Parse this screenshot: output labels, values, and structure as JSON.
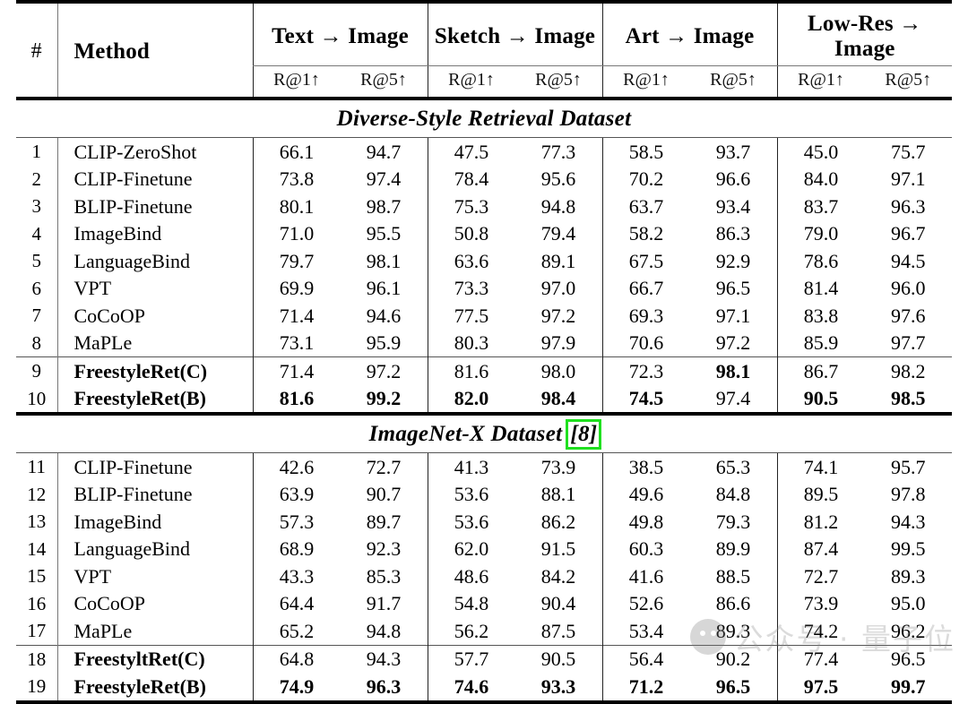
{
  "table": {
    "columns": {
      "num_header": "#",
      "method_header": "Method",
      "groups": [
        {
          "label": "Text → Image",
          "metrics": [
            "R@1↑",
            "R@5↑"
          ]
        },
        {
          "label": "Sketch → Image",
          "metrics": [
            "R@1↑",
            "R@5↑"
          ]
        },
        {
          "label": "Art → Image",
          "metrics": [
            "R@1↑",
            "R@5↑"
          ]
        },
        {
          "label": "Low-Res → Image",
          "metrics": [
            "R@1↑",
            "R@5↑"
          ]
        }
      ]
    },
    "sections": [
      {
        "banner": "Diverse-Style Retrieval Dataset",
        "banner_citation": "",
        "rows": [
          {
            "num": "1",
            "method": "CLIP-ZeroShot",
            "bold_method": false,
            "values": [
              "66.1",
              "94.7",
              "47.5",
              "77.3",
              "58.5",
              "93.7",
              "45.0",
              "75.7"
            ],
            "bold": [
              false,
              false,
              false,
              false,
              false,
              false,
              false,
              false
            ]
          },
          {
            "num": "2",
            "method": "CLIP-Finetune",
            "bold_method": false,
            "values": [
              "73.8",
              "97.4",
              "78.4",
              "95.6",
              "70.2",
              "96.6",
              "84.0",
              "97.1"
            ],
            "bold": [
              false,
              false,
              false,
              false,
              false,
              false,
              false,
              false
            ]
          },
          {
            "num": "3",
            "method": "BLIP-Finetune",
            "bold_method": false,
            "values": [
              "80.1",
              "98.7",
              "75.3",
              "94.8",
              "63.7",
              "93.4",
              "83.7",
              "96.3"
            ],
            "bold": [
              false,
              false,
              false,
              false,
              false,
              false,
              false,
              false
            ]
          },
          {
            "num": "4",
            "method": "ImageBind",
            "bold_method": false,
            "values": [
              "71.0",
              "95.5",
              "50.8",
              "79.4",
              "58.2",
              "86.3",
              "79.0",
              "96.7"
            ],
            "bold": [
              false,
              false,
              false,
              false,
              false,
              false,
              false,
              false
            ]
          },
          {
            "num": "5",
            "method": "LanguageBind",
            "bold_method": false,
            "values": [
              "79.7",
              "98.1",
              "63.6",
              "89.1",
              "67.5",
              "92.9",
              "78.6",
              "94.5"
            ],
            "bold": [
              false,
              false,
              false,
              false,
              false,
              false,
              false,
              false
            ]
          },
          {
            "num": "6",
            "method": "VPT",
            "bold_method": false,
            "values": [
              "69.9",
              "96.1",
              "73.3",
              "97.0",
              "66.7",
              "96.5",
              "81.4",
              "96.0"
            ],
            "bold": [
              false,
              false,
              false,
              false,
              false,
              false,
              false,
              false
            ]
          },
          {
            "num": "7",
            "method": "CoCoOP",
            "bold_method": false,
            "values": [
              "71.4",
              "94.6",
              "77.5",
              "97.2",
              "69.3",
              "97.1",
              "83.8",
              "97.6"
            ],
            "bold": [
              false,
              false,
              false,
              false,
              false,
              false,
              false,
              false
            ]
          },
          {
            "num": "8",
            "method": "MaPLe",
            "bold_method": false,
            "values": [
              "73.1",
              "95.9",
              "80.3",
              "97.9",
              "70.6",
              "97.2",
              "85.9",
              "97.7"
            ],
            "bold": [
              false,
              false,
              false,
              false,
              false,
              false,
              false,
              false
            ]
          }
        ],
        "highlight_rows": [
          {
            "num": "9",
            "method": "FreestyleRet(C)",
            "bold_method": true,
            "values": [
              "71.4",
              "97.2",
              "81.6",
              "98.0",
              "72.3",
              "98.1",
              "86.7",
              "98.2"
            ],
            "bold": [
              false,
              false,
              false,
              false,
              false,
              true,
              false,
              false
            ]
          },
          {
            "num": "10",
            "method": "FreestyleRet(B)",
            "bold_method": true,
            "values": [
              "81.6",
              "99.2",
              "82.0",
              "98.4",
              "74.5",
              "97.4",
              "90.5",
              "98.5"
            ],
            "bold": [
              true,
              true,
              true,
              true,
              true,
              false,
              true,
              true
            ]
          }
        ]
      },
      {
        "banner": "ImageNet-X Dataset",
        "banner_citation": "[8]",
        "rows": [
          {
            "num": "11",
            "method": "CLIP-Finetune",
            "bold_method": false,
            "values": [
              "42.6",
              "72.7",
              "41.3",
              "73.9",
              "38.5",
              "65.3",
              "74.1",
              "95.7"
            ],
            "bold": [
              false,
              false,
              false,
              false,
              false,
              false,
              false,
              false
            ]
          },
          {
            "num": "12",
            "method": "BLIP-Finetune",
            "bold_method": false,
            "values": [
              "63.9",
              "90.7",
              "53.6",
              "88.1",
              "49.6",
              "84.8",
              "89.5",
              "97.8"
            ],
            "bold": [
              false,
              false,
              false,
              false,
              false,
              false,
              false,
              false
            ]
          },
          {
            "num": "13",
            "method": "ImageBind",
            "bold_method": false,
            "values": [
              "57.3",
              "89.7",
              "53.6",
              "86.2",
              "49.8",
              "79.3",
              "81.2",
              "94.3"
            ],
            "bold": [
              false,
              false,
              false,
              false,
              false,
              false,
              false,
              false
            ]
          },
          {
            "num": "14",
            "method": "LanguageBind",
            "bold_method": false,
            "values": [
              "68.9",
              "92.3",
              "62.0",
              "91.5",
              "60.3",
              "89.9",
              "87.4",
              "99.5"
            ],
            "bold": [
              false,
              false,
              false,
              false,
              false,
              false,
              false,
              false
            ]
          },
          {
            "num": "15",
            "method": "VPT",
            "bold_method": false,
            "values": [
              "43.3",
              "85.3",
              "48.6",
              "84.2",
              "41.6",
              "88.5",
              "72.7",
              "89.3"
            ],
            "bold": [
              false,
              false,
              false,
              false,
              false,
              false,
              false,
              false
            ]
          },
          {
            "num": "16",
            "method": "CoCoOP",
            "bold_method": false,
            "values": [
              "64.4",
              "91.7",
              "54.8",
              "90.4",
              "52.6",
              "86.6",
              "73.9",
              "95.0"
            ],
            "bold": [
              false,
              false,
              false,
              false,
              false,
              false,
              false,
              false
            ]
          },
          {
            "num": "17",
            "method": "MaPLe",
            "bold_method": false,
            "values": [
              "65.2",
              "94.8",
              "56.2",
              "87.5",
              "53.4",
              "89.3",
              "74.2",
              "96.2"
            ],
            "bold": [
              false,
              false,
              false,
              false,
              false,
              false,
              false,
              false
            ]
          }
        ],
        "highlight_rows": [
          {
            "num": "18",
            "method": "FreestyltRet(C)",
            "bold_method": true,
            "values": [
              "64.8",
              "94.3",
              "57.7",
              "90.5",
              "56.4",
              "90.2",
              "77.4",
              "96.5"
            ],
            "bold": [
              false,
              false,
              false,
              false,
              false,
              false,
              false,
              false
            ]
          },
          {
            "num": "19",
            "method": "FreestyleRet(B)",
            "bold_method": true,
            "values": [
              "74.9",
              "96.3",
              "74.6",
              "93.3",
              "71.2",
              "96.5",
              "97.5",
              "99.7"
            ],
            "bold": [
              true,
              true,
              true,
              true,
              true,
              true,
              true,
              true
            ]
          }
        ]
      }
    ]
  },
  "watermark": {
    "text": "公众号 · 量子位",
    "logo": "wechat-official-account-logo"
  },
  "colors": {
    "highlight_box": "#1fe01f",
    "rule": "#000000",
    "thin_rule": "#555555",
    "watermark_text": "#8a8a8a"
  }
}
